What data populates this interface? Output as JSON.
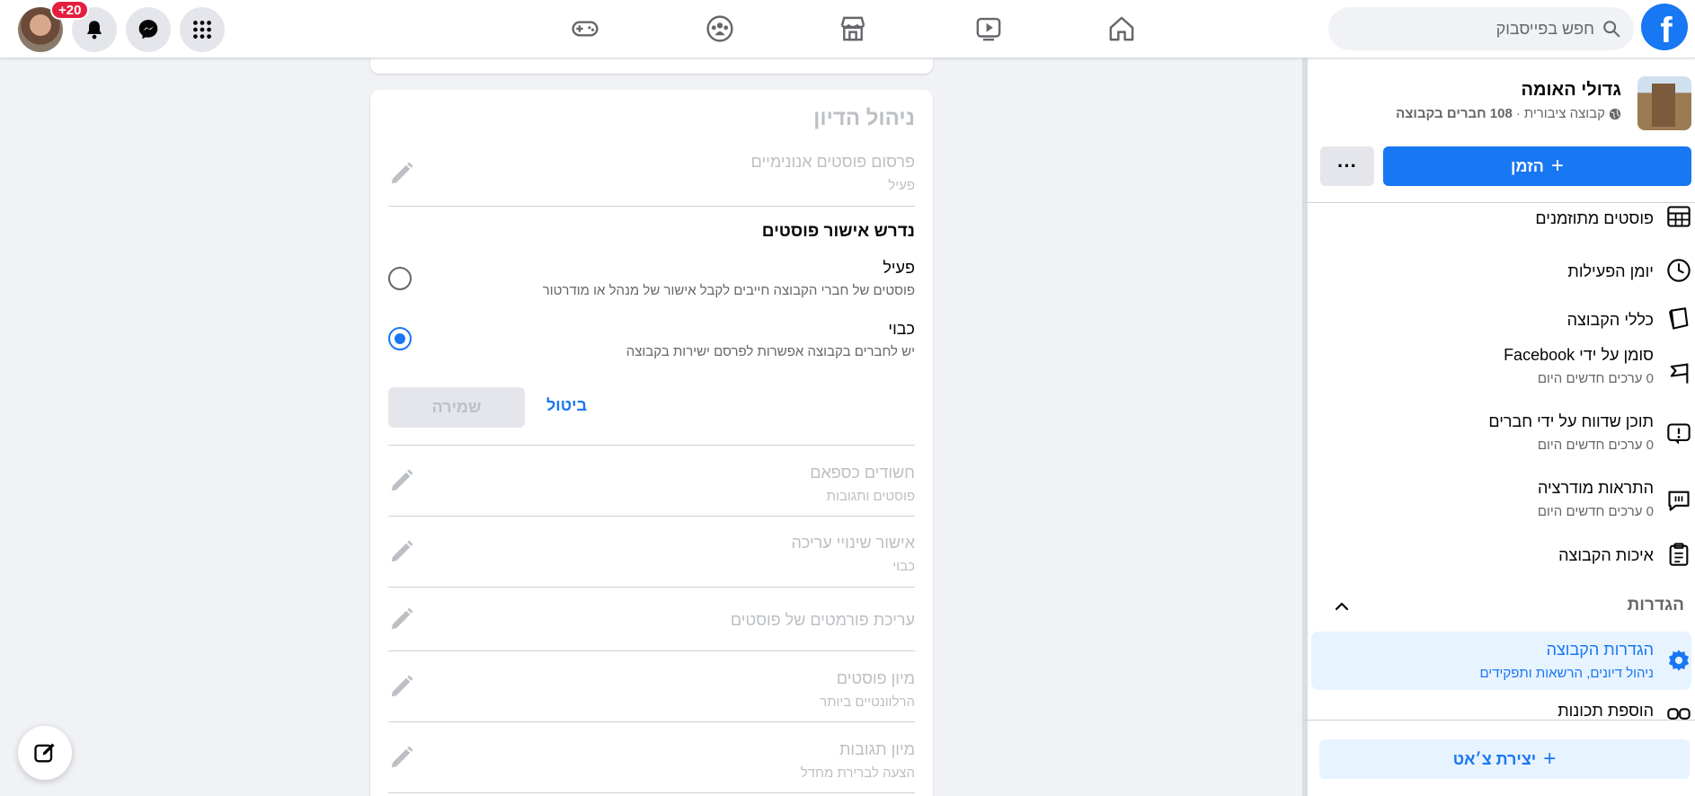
{
  "topbar": {
    "logo_letter": "f",
    "search_placeholder": "חפש בפייסבוק",
    "notification_count": "+20"
  },
  "discussion": {
    "title": "ניהול הדיון",
    "anon_posts": {
      "title": "פרסום פוסטים אנונימיים",
      "status": "פעיל"
    },
    "approval": {
      "title": "נדרש אישור פוסטים",
      "options": [
        {
          "label": "פעיל",
          "desc": "פוסטים של חברי הקבוצה חייבים לקבל אישור של מנהל או מודרטור",
          "selected": false
        },
        {
          "label": "כבוי",
          "desc": "יש לחברים בקבוצה אפשרות לפרסם ישירות בקבוצה",
          "selected": true
        }
      ],
      "save_label": "שמירה",
      "cancel_label": "ביטול"
    },
    "rows": [
      {
        "title": "חשודים כספאם",
        "status": "פוסטים ותגובות"
      },
      {
        "title": "אישור שינויי עריכה",
        "status": "כבוי"
      },
      {
        "title": "עריכת פורמטים של פוסטים",
        "status": ""
      },
      {
        "title": "מיון פוסטים",
        "status": "הרלוונטיים ביותר"
      },
      {
        "title": "מיון תגובות",
        "status": "הצעה לברירת מחדל"
      }
    ]
  },
  "group": {
    "name": "גדולי האומה",
    "privacy": "קבוצה ציבורית",
    "separator": "·",
    "members": "108 חברים בקבוצה",
    "invite_label": "הזמן",
    "more_label": "···"
  },
  "sidebar": {
    "items": [
      {
        "label": "פוסטים מתוזמנים",
        "sub": ""
      },
      {
        "label": "יומן הפעילות",
        "sub": ""
      },
      {
        "label": "כללי הקבוצה",
        "sub": ""
      },
      {
        "label": "סומן על ידי Facebook",
        "sub": "0 ערכים חדשים היום"
      },
      {
        "label": "תוכן שדווח על ידי חברים",
        "sub": "0 ערכים חדשים היום"
      },
      {
        "label": "התראות מודרציה",
        "sub": "0 ערכים חדשים היום"
      },
      {
        "label": "איכות הקבוצה",
        "sub": ""
      }
    ],
    "settings_header": "הגדרות",
    "settings_items": [
      {
        "label": "הגדרות הקבוצה",
        "sub": "ניהול דיונים, הרשאות ותפקידים"
      },
      {
        "label": "הוספת תכונות",
        "sub": ""
      }
    ],
    "chat_label": "יצירת צ׳אט"
  },
  "colors": {
    "accent": "#1877f2",
    "muted": "#bcc0c4",
    "badge": "#e41e3f"
  }
}
